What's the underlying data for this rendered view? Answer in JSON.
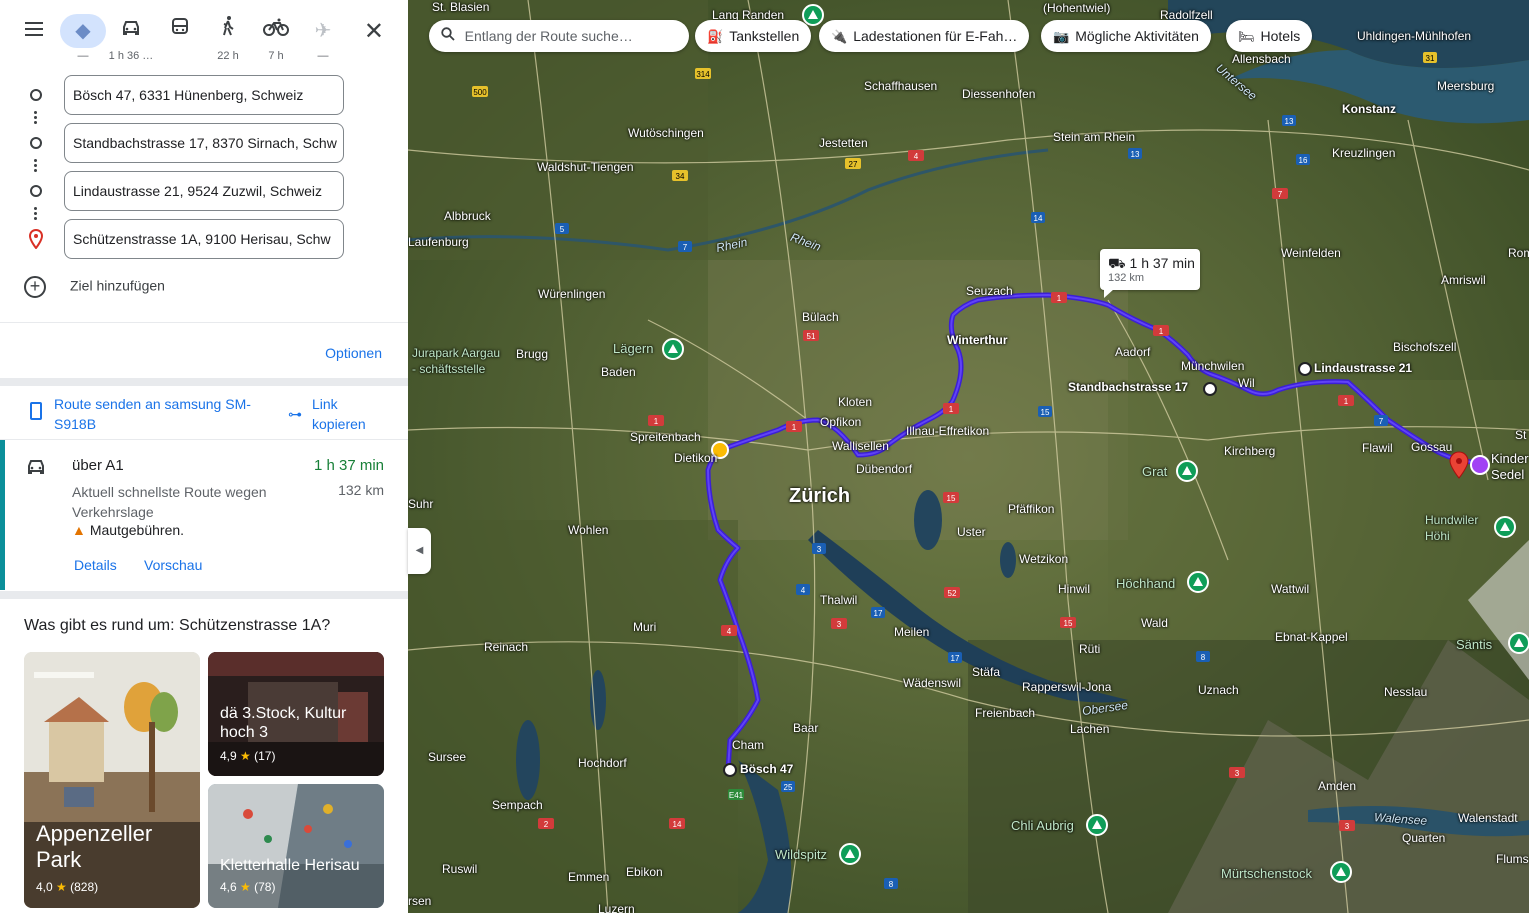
{
  "modes": [
    {
      "name": "best",
      "label": "—",
      "icon": "diamond-route-icon"
    },
    {
      "name": "car",
      "label": "1 h 36 …",
      "icon": "car-icon"
    },
    {
      "name": "transit",
      "label": "",
      "icon": "bus-icon"
    },
    {
      "name": "walk",
      "label": "22 h",
      "icon": "walk-icon"
    },
    {
      "name": "bike",
      "label": "7 h",
      "icon": "bike-icon"
    },
    {
      "name": "flight",
      "label": "—",
      "icon": "plane-icon"
    }
  ],
  "stops": [
    "Bösch 47, 6331 Hünenberg, Schweiz",
    "Standbachstrasse 17, 8370 Sirnach, Schw",
    "Lindaustrasse 21, 9524 Zuzwil, Schweiz",
    "Schützenstrasse 1A, 9100 Herisau, Schw"
  ],
  "add_destination": "Ziel hinzufügen",
  "options": "Optionen",
  "send_route": "Route senden an samsung SM-S918B",
  "copy_link": "Link kopieren",
  "route": {
    "via": "über A1",
    "time": "1 h 37 min",
    "description": "Aktuell schnellste Route wegen Verkehrslage",
    "distance": "132 km",
    "toll": "Mautgebühren.",
    "details": "Details",
    "preview": "Vorschau"
  },
  "nearby": {
    "title": "Was gibt es rund um: Schützenstrasse 1A?",
    "cards": [
      {
        "name": "Appenzeller Park",
        "rating": "4,0",
        "count": "(828)"
      },
      {
        "name": "dä 3.Stock, Kultur hoch 3",
        "rating": "4,9",
        "count": "(17)"
      },
      {
        "name": "Kletterhalle Herisau",
        "rating": "4,6",
        "count": "(78)"
      }
    ]
  },
  "map": {
    "search_placeholder": "Entlang der Route suche…",
    "chips": [
      "Tankstellen",
      "Ladestationen für E-Fah…",
      "Mögliche Aktivitäten",
      "Hotels"
    ],
    "callout_time": "1 h 37 min",
    "callout_distance": "132 km",
    "route_color": "#4a1fe0",
    "labels": {
      "zurich": "Zürich",
      "winterthur": "Winterthur",
      "standbach": "Standbachstrasse 17",
      "lindau": "Lindaustrasse 21",
      "bosch": "Bösch 47",
      "st_blasien": "St. Blasien",
      "lang_randen": "Lang Randen",
      "hohentwiel": "(Hohentwiel)",
      "radolfzell": "Radolfzell",
      "uhldingen": "Uhldingen-Mühlhofen",
      "allensbach": "Allensbach",
      "untersee": "Untersee",
      "konstanz": "Konstanz",
      "meersburg": "Meersburg",
      "schaffhausen": "Schaffhausen",
      "diessenhofen": "Diessenhofen",
      "wutoschingen": "Wutöschingen",
      "jestetten": "Jestetten",
      "stein": "Stein am Rhein",
      "kreuzlingen": "Kreuzlingen",
      "waldshut": "Waldshut-Tiengen",
      "albbruck": "Albbruck",
      "laufenburg": "Laufenburg",
      "rhein1": "Rhein",
      "rhein2": "Rhein",
      "weinfelden": "Weinfelden",
      "amriswil": "Amriswil",
      "romanshorn": "Rom",
      "wurenlingen": "Würenlingen",
      "bulach": "Bülach",
      "seuzach": "Seuzach",
      "jurapark": "Jurapark Aargau - schäftsstelle",
      "lagern": "Lägern",
      "brugg": "Brugg",
      "baden": "Baden",
      "aadorf": "Aadorf",
      "munchwilen": "Münchwilen",
      "wil": "Wil",
      "bischofszell": "Bischofszell",
      "kloten": "Kloten",
      "opfikon": "Opfikon",
      "wallisellen": "Wallisellen",
      "illnau": "Illnau-Effretikon",
      "spreitenbach": "Spreitenbach",
      "dietikon": "Dietikon",
      "dubendorf": "Dübendorf",
      "kirchberg": "Kirchberg",
      "flawil": "Flawil",
      "gossau": "Gossau",
      "kinder": "Kinder",
      "sedel": "Sedel",
      "st": "St",
      "grat": "Grat",
      "hundwiler": "Hundwiler Höhi",
      "wohlen": "Wohlen",
      "pfaffikon": "Pfäffikon",
      "uster": "Uster",
      "suhr": "Suhr",
      "wetzikon": "Wetzikon",
      "hinwil": "Hinwil",
      "hochhand": "Hörnli... Höchhand",
      "wattwil": "Wattwil",
      "thalwil": "Thalwil",
      "muri": "Muri",
      "meilen": "Meilen",
      "reinach": "Reinach",
      "wald": "Wald",
      "ruti": "Rüti",
      "ebnat": "Ebnat-Kappel",
      "santis": "Säntis",
      "wadenswil": "Wädenswil",
      "stafa": "Stäfa",
      "rapperswil": "Rapperswil-Jona",
      "uznach": "Uznach",
      "nesslau": "Nesslau",
      "freienbach": "Freienbach",
      "obersee": "Obersee",
      "cham": "Cham",
      "baar": "Baar",
      "lachen": "Lachen",
      "sursee": "Sursee",
      "hochdorf": "Hochdorf",
      "amden": "Amden",
      "sempach": "Sempach",
      "chli_aubrig": "Chli Aubrig",
      "walensee": "Walensee",
      "walenstadt": "Walenstadt",
      "quarten": "Quarten",
      "wildspitz": "Wildspitz",
      "murtschenstock": "Mürtschenstock",
      "flums": "Flums",
      "ruswil": "Ruswil",
      "emmen": "Emmen",
      "ebikon": "Ebikon",
      "sursen": "rsen",
      "luzern": "Luzern"
    }
  }
}
